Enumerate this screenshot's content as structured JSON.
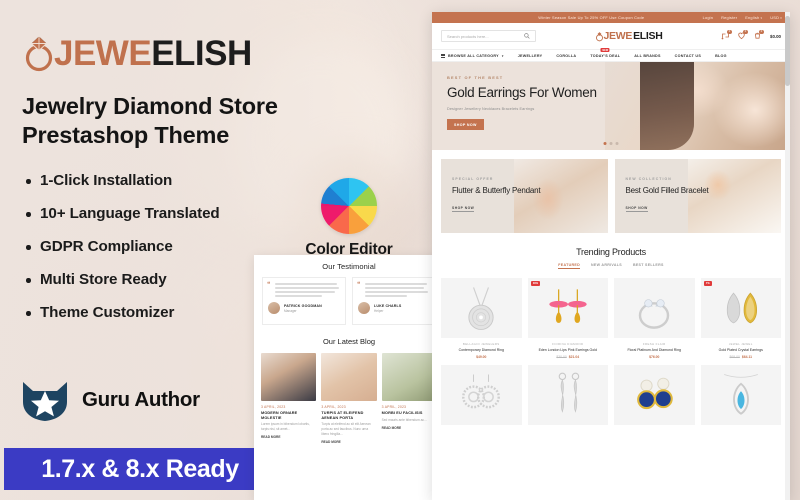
{
  "left": {
    "logo": {
      "icon": "diamond-ring-icon",
      "accent_text": "JEWE",
      "dark_text": "ELISH",
      "accent_color": "#c0714d"
    },
    "headline_line1": "Jewelry Diamond Store",
    "headline_line2": "Prestashop Theme",
    "features": [
      "1-Click Installation",
      "10+ Language Translated",
      "GDPR Compliance",
      "Multi Store Ready",
      "Theme Customizer"
    ],
    "color_editor": {
      "label": "Color Editor",
      "icon": "color-wheel-icon"
    },
    "guru": {
      "label": "Guru Author",
      "icon": "guru-cat-shield-icon",
      "color": "#1e4461"
    },
    "version_banner": {
      "label": "1.7.x & 8.x Ready",
      "background": "#3b3bc4",
      "text_color": "#ffffff"
    }
  },
  "mid_mockup": {
    "testimonial": {
      "title": "Our Testimonial",
      "cards": [
        {
          "name": "PATRICK GOODMAN",
          "role": "Manager",
          "quote_icon": "quote-icon"
        },
        {
          "name": "LUKE CHARLS",
          "role": "Helper",
          "quote_icon": "quote-icon"
        }
      ]
    },
    "blog": {
      "title": "Our Latest Blog",
      "posts": [
        {
          "date": "3 APRIL, 2023",
          "title": "MODERN ORNARE MOLESTIE",
          "excerpt": "Lorem ipsum in bibendum lobortis, turpis nisi, sit amet...",
          "more": "READ MORE"
        },
        {
          "date": "3 APRIL, 2023",
          "title": "TURPIS AT ELEIFEND AENEAN PORTA",
          "excerpt": "Turpis at eleifend ac sit elit Aenean porta ac sed faucibus. Nunc urna libero fringilla...",
          "more": "READ MORE"
        },
        {
          "date": "3 APRIL, 2023",
          "title": "MORBI EU FACILISIS",
          "excerpt": "Sed mauris ante bibendum ac...",
          "more": "READ MORE"
        }
      ]
    }
  },
  "site": {
    "promo_bar": {
      "message": "Winter Season Sale Up To 25% OFF Use Coupon Code",
      "login": "Login",
      "register": "Register",
      "language": "English",
      "currency": "USD"
    },
    "header": {
      "search_placeholder": "Search products here...",
      "search_icon": "search-icon",
      "logo_accent": "JEWE",
      "logo_dark": "ELISH",
      "compare_count": "0",
      "wishlist_count": "0",
      "cart_count": "0",
      "cart_amount": "$0.00"
    },
    "nav": {
      "category_label": "BROWSE ALL CATEGORY",
      "items": [
        {
          "label": "JEWELLERY",
          "badge": ""
        },
        {
          "label": "COROLLA",
          "badge": ""
        },
        {
          "label": "TODAY'S DEAL",
          "badge": "NEW"
        },
        {
          "label": "ALL BRANDS",
          "badge": ""
        },
        {
          "label": "CONTACT US",
          "badge": ""
        },
        {
          "label": "BLOG",
          "badge": ""
        }
      ]
    },
    "hero": {
      "eyebrow": "BEST OF THE BEST",
      "title": "Gold Earrings For Women",
      "subtitle": "Designer Jewellery Necklaces Bracelets Earrings",
      "cta": "SHOP NOW"
    },
    "promo_cards": [
      {
        "eyebrow": "SPECIAL OFFER",
        "title": "Flutter & Butterfly Pendant",
        "cta": "SHOP NOW"
      },
      {
        "eyebrow": "NEW COLLECTION",
        "title": "Best Gold Filled Bracelet",
        "cta": "SHOP NOW"
      }
    ],
    "trending": {
      "title": "Trending Products",
      "tabs": [
        {
          "label": "FEATURED",
          "active": true
        },
        {
          "label": "NEW ARRIVALS",
          "active": false
        },
        {
          "label": "BEST SELLERS",
          "active": false
        }
      ],
      "products": [
        {
          "brand": "BELLAGIO JEWELERS",
          "name": "Contemporary Diamond Ring",
          "price": "$49.00",
          "old_price": "",
          "badge": "",
          "image": "diamond-pendant-necklace"
        },
        {
          "brand": "FIORINA DIAMOND",
          "name": "Eden London Lips Pink Earrings Gold",
          "price": "$21.04",
          "old_price": "$30.00",
          "badge": "30%",
          "image": "pink-gold-drop-earrings"
        },
        {
          "brand": "FRESH FLAIR",
          "name": "Floral Platinum And Diamond Ring",
          "price": "$76.00",
          "old_price": "",
          "badge": "",
          "image": "platinum-diamond-ring"
        },
        {
          "brand": "JEWEL JEWEL",
          "name": "Gold Plated Crystal Earrings",
          "price": "$64.11",
          "old_price": "$69.00",
          "badge": "7%",
          "image": "gold-crystal-hoop-earrings"
        },
        {
          "brand": "",
          "name": "",
          "price": "",
          "old_price": "",
          "badge": "",
          "image": "silver-filigree-earrings"
        },
        {
          "brand": "",
          "name": "",
          "price": "",
          "old_price": "",
          "badge": "",
          "image": "silver-twist-drop-earrings"
        },
        {
          "brand": "",
          "name": "",
          "price": "",
          "old_price": "",
          "badge": "",
          "image": "blue-pearl-gold-earrings"
        },
        {
          "brand": "",
          "name": "",
          "price": "",
          "old_price": "",
          "badge": "",
          "image": "blue-topaz-pendant"
        }
      ]
    }
  }
}
